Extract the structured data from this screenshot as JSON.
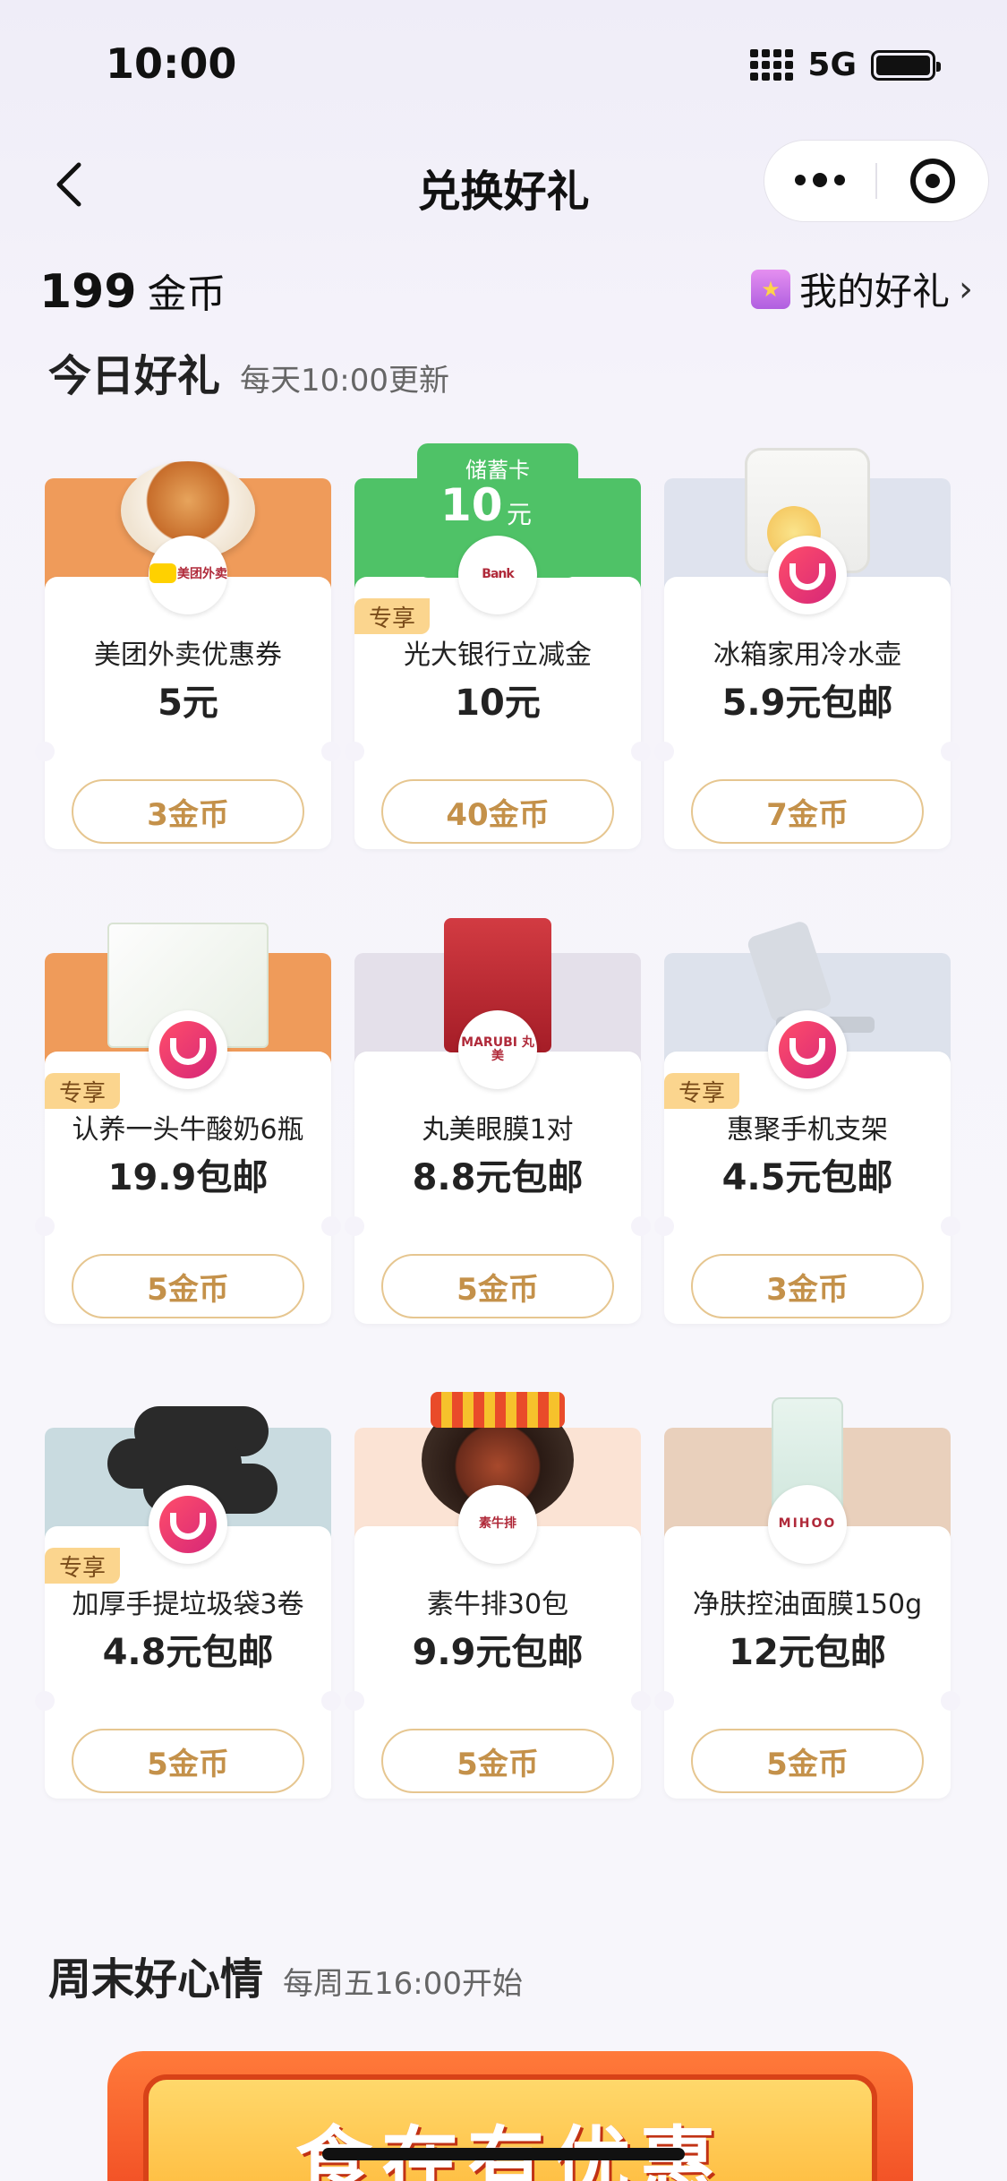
{
  "status_bar": {
    "time": "10:00",
    "network": "5G"
  },
  "nav": {
    "title": "兑换好礼"
  },
  "coins": {
    "amount": "199",
    "unit": "金币"
  },
  "my_gifts": {
    "label": "我的好礼",
    "chevron": "›"
  },
  "today": {
    "title": "今日好礼",
    "subtitle": "每天10:00更新"
  },
  "weekend": {
    "title": "周末好心情",
    "subtitle": "每周五16:00开始",
    "banner_text": "食在有优惠"
  },
  "exclusive_tag": "专享",
  "items": [
    {
      "name": "美团外卖优惠券",
      "price": "5元",
      "cost": "3金币",
      "exclusive": false,
      "logo": "美团外卖",
      "bg": "#ef9b5a",
      "product": "plate"
    },
    {
      "name": "光大银行立减金",
      "price": "10元",
      "cost": "40金币",
      "exclusive": true,
      "logo": "Bank",
      "bg": "#4fc267",
      "product": "ticket",
      "ticket": {
        "type": "储蓄卡",
        "amount": "10",
        "unit": "元"
      }
    },
    {
      "name": "冰箱家用冷水壶",
      "price": "5.9元包邮",
      "cost": "7金币",
      "exclusive": false,
      "logo": "smile",
      "bg": "#dfe3ee",
      "product": "pitcher"
    },
    {
      "name": "认养一头牛酸奶6瓶",
      "price": "19.9包邮",
      "cost": "5金币",
      "exclusive": true,
      "logo": "smile",
      "bg": "#ef9b5a",
      "product": "box"
    },
    {
      "name": "丸美眼膜1对",
      "price": "8.8元包邮",
      "cost": "5金币",
      "exclusive": false,
      "logo": "MARUBI 丸美",
      "bg": "#e4e0ea",
      "product": "mask"
    },
    {
      "name": "惠聚手机支架",
      "price": "4.5元包邮",
      "cost": "3金币",
      "exclusive": true,
      "logo": "smile",
      "bg": "#dde2ec",
      "product": "stand"
    },
    {
      "name": "加厚手提垃圾袋3卷",
      "price": "4.8元包邮",
      "cost": "5金币",
      "exclusive": true,
      "logo": "smile",
      "bg": "#c9dbe0",
      "product": "rolls"
    },
    {
      "name": "素牛排30包",
      "price": "9.9元包邮",
      "cost": "5金币",
      "exclusive": false,
      "logo": "素牛排",
      "bg": "#fbe3d4",
      "product": "bowl"
    },
    {
      "name": "净肤控油面膜150g",
      "price": "12元包邮",
      "cost": "5金币",
      "exclusive": false,
      "logo": "MIHOO",
      "bg": "#e9d0bc",
      "product": "pouch"
    }
  ]
}
